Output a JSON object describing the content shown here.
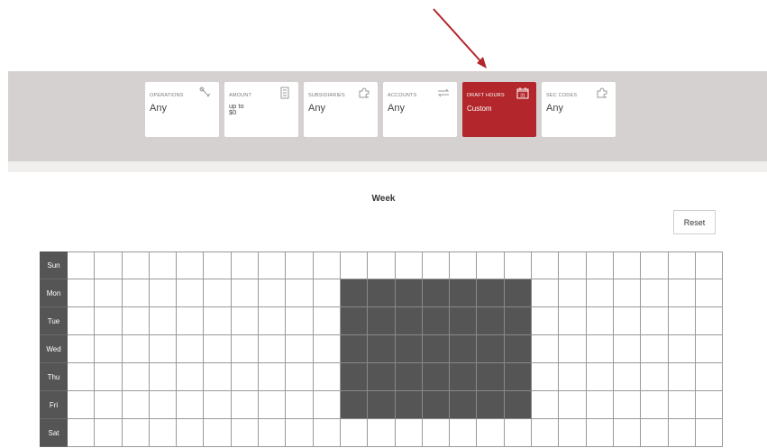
{
  "filters": [
    {
      "id": "operations",
      "label": "OPERATIONS",
      "value": "Any",
      "icon": "wrench-icon",
      "active": false
    },
    {
      "id": "amount",
      "label": "AMOUNT",
      "value": "up to\n$0",
      "icon": "building-icon",
      "active": false
    },
    {
      "id": "subsidiaries",
      "label": "SUBSIDIARIES",
      "value": "Any",
      "icon": "puzzle-icon",
      "active": false
    },
    {
      "id": "accounts",
      "label": "ACCOUNTS",
      "value": "Any",
      "icon": "transfer-arrows-icon",
      "active": false
    },
    {
      "id": "draft_hours",
      "label": "DRAFT HOURS",
      "value": "Custom",
      "icon": "calendar-icon",
      "active": true
    },
    {
      "id": "sec_codes",
      "label": "SEC CODES",
      "value": "Any",
      "icon": "puzzle-icon",
      "active": false
    }
  ],
  "schedule": {
    "title": "Week",
    "reset_label": "Reset",
    "days": [
      "Sun",
      "Mon",
      "Tue",
      "Wed",
      "Thu",
      "Fri",
      "Sat"
    ],
    "columns": 24,
    "selected": {
      "rows": [
        1,
        2,
        3,
        4,
        5
      ],
      "cols": [
        10,
        11,
        12,
        13,
        14,
        15,
        16
      ]
    }
  },
  "colors": {
    "accent": "#b3262b",
    "selected_cell": "#555555",
    "band": "#d6d1d1"
  }
}
